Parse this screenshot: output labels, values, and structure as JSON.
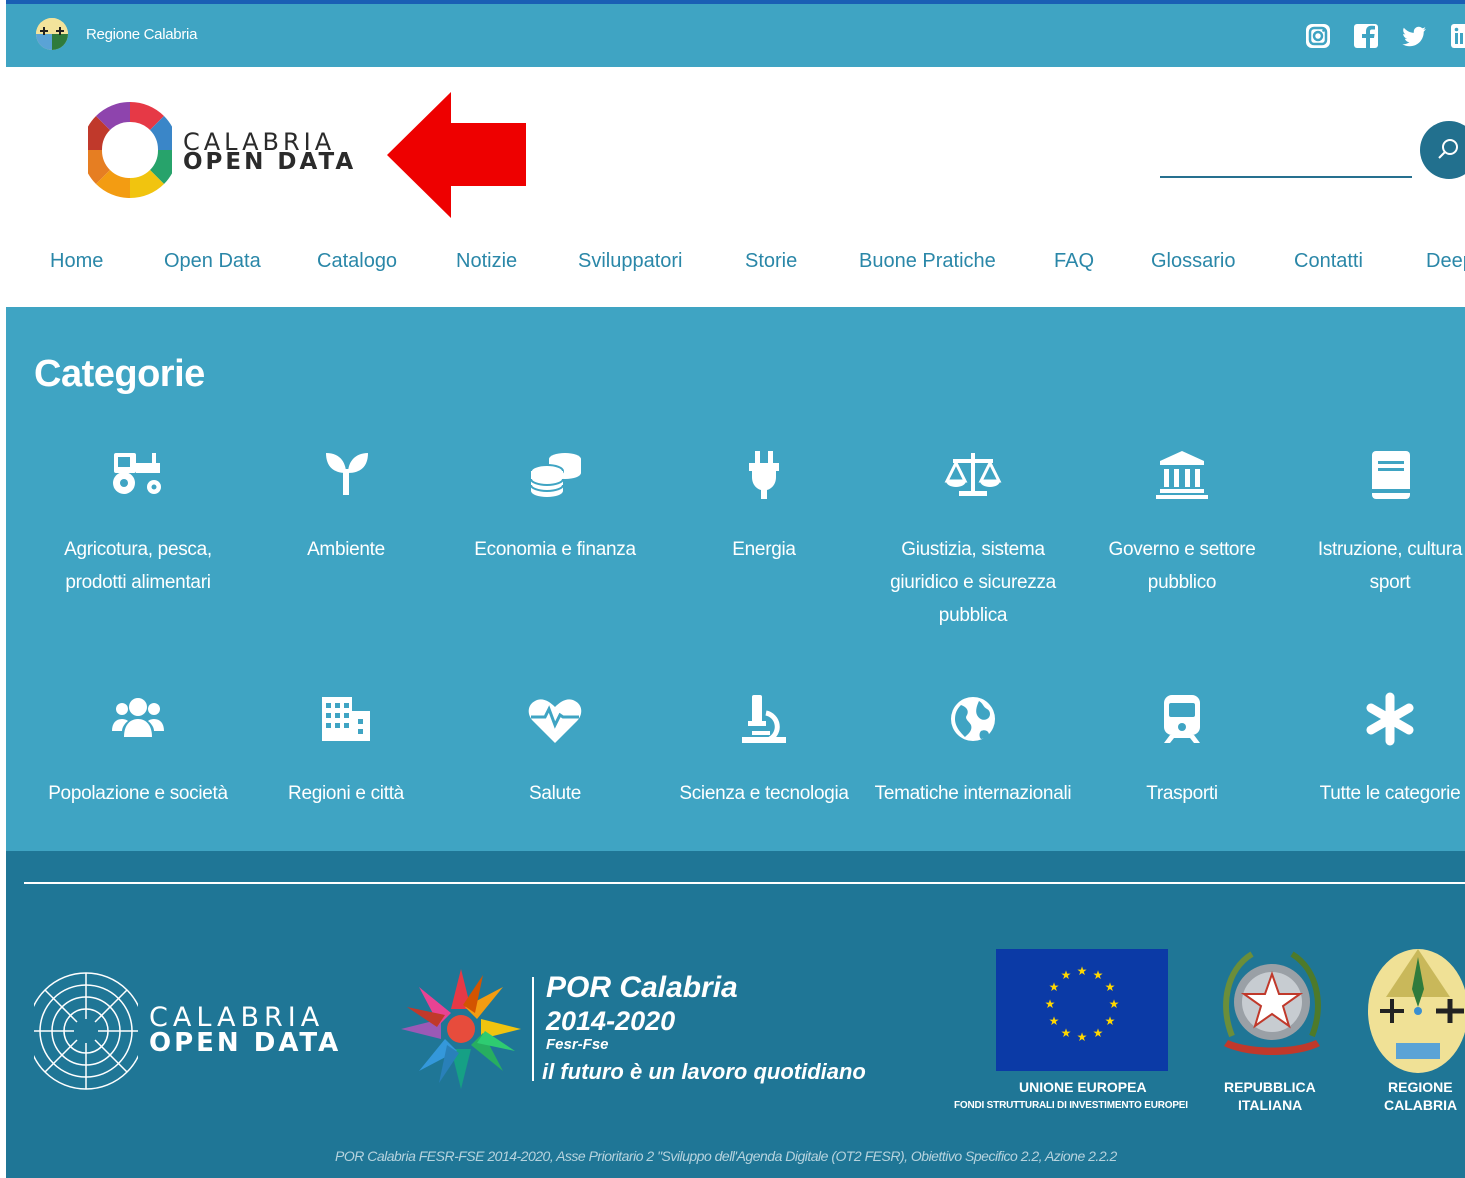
{
  "topbar": {
    "region_name": "Regione Calabria",
    "social": [
      "instagram-icon",
      "facebook-icon",
      "twitter-icon",
      "linkedin-icon"
    ]
  },
  "header": {
    "logo_line1": "CALABRIA",
    "logo_line2": "OPEN DATA",
    "search_placeholder": ""
  },
  "nav": {
    "items": [
      "Home",
      "Open Data",
      "Catalogo",
      "Notizie",
      "Sviluppatori",
      "Storie",
      "Buone Pratiche",
      "FAQ",
      "Glossario",
      "Contatti",
      "Deep"
    ]
  },
  "categories": {
    "title": "Categorie",
    "items": [
      {
        "label_line1": "Agricotura, pesca,",
        "label_line2": "prodotti alimentari",
        "label_line3": "",
        "icon": "tractor-icon"
      },
      {
        "label_line1": "Ambiente",
        "label_line2": "",
        "label_line3": "",
        "icon": "seedling-icon"
      },
      {
        "label_line1": "Economia e finanza",
        "label_line2": "",
        "label_line3": "",
        "icon": "coins-icon"
      },
      {
        "label_line1": "Energia",
        "label_line2": "",
        "label_line3": "",
        "icon": "plug-icon"
      },
      {
        "label_line1": "Giustizia, sistema",
        "label_line2": "giuridico e sicurezza",
        "label_line3": "pubblica",
        "icon": "balance-scale-icon"
      },
      {
        "label_line1": "Governo e settore",
        "label_line2": "pubblico",
        "label_line3": "",
        "icon": "landmark-icon"
      },
      {
        "label_line1": "Istruzione, cultura",
        "label_line2": "sport",
        "label_line3": "",
        "icon": "book-icon"
      },
      {
        "label_line1": "Popolazione e società",
        "label_line2": "",
        "label_line3": "",
        "icon": "users-icon"
      },
      {
        "label_line1": "Regioni e città",
        "label_line2": "",
        "label_line3": "",
        "icon": "city-icon"
      },
      {
        "label_line1": "Salute",
        "label_line2": "",
        "label_line3": "",
        "icon": "heartbeat-icon"
      },
      {
        "label_line1": "Scienza e tecnologia",
        "label_line2": "",
        "label_line3": "",
        "icon": "microscope-icon"
      },
      {
        "label_line1": "Tematiche internazionali",
        "label_line2": "",
        "label_line3": "",
        "icon": "globe-icon"
      },
      {
        "label_line1": "Trasporti",
        "label_line2": "",
        "label_line3": "",
        "icon": "train-icon"
      },
      {
        "label_line1": "Tutte le categorie",
        "label_line2": "",
        "label_line3": "",
        "icon": "asterisk-icon"
      }
    ]
  },
  "footer": {
    "logo_line1": "CALABRIA",
    "logo_line2": "OPEN DATA",
    "por_title": "POR Calabria",
    "por_years": "2014-2020",
    "por_fund": "Fesr-Fse",
    "por_motto": "il futuro è un lavoro quotidiano",
    "eu_name": "UNIONE EUROPEA",
    "eu_funds": "FONDI STRUTTURALI DI INVESTIMENTO EUROPEI",
    "rep_line1": "REPUBBLICA",
    "rep_line2": "ITALIANA",
    "cal_line1": "REGIONE",
    "cal_line2": "CALABRIA",
    "note": "POR Calabria FESR-FSE 2014-2020, Asse Prioritario 2 \"Sviluppo dell'Agenda Digitale (OT2 FESR), Obiettivo Specifico 2.2, Azione 2.2.2"
  },
  "colors": {
    "primary": "#3fa4c3",
    "footer": "#1f7696",
    "nav_link": "#2a87a8",
    "arrow": "#ee0000"
  }
}
